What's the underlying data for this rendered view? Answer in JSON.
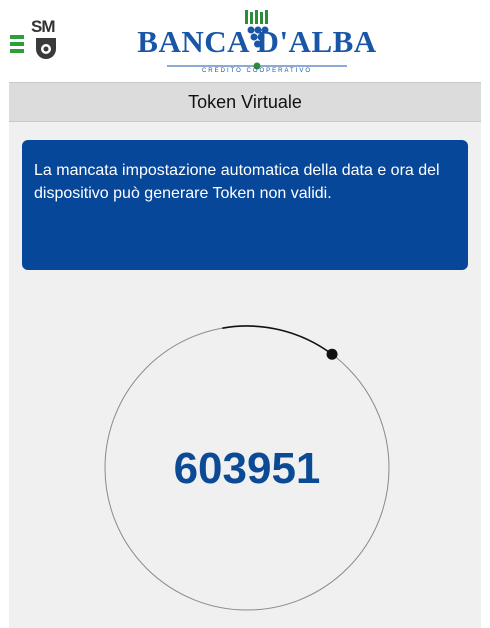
{
  "header": {
    "menu_icon": "hamburger-menu-icon",
    "sm_logo_text": "SM",
    "brand_name": "BANCA D'ALBA",
    "brand_subtitle": "CREDITO COOPERATIVO",
    "colors": {
      "brand": "#1a56a8",
      "menu": "#2e9e3a"
    }
  },
  "title": "Token Virtuale",
  "notice": {
    "text": "La mancata impostazione automatica della data e ora del dispositivo può generare Token non validi.",
    "background": "#07479a"
  },
  "token": {
    "code": "603951",
    "timer_progress": 0.13,
    "code_color": "#0c4a96"
  }
}
